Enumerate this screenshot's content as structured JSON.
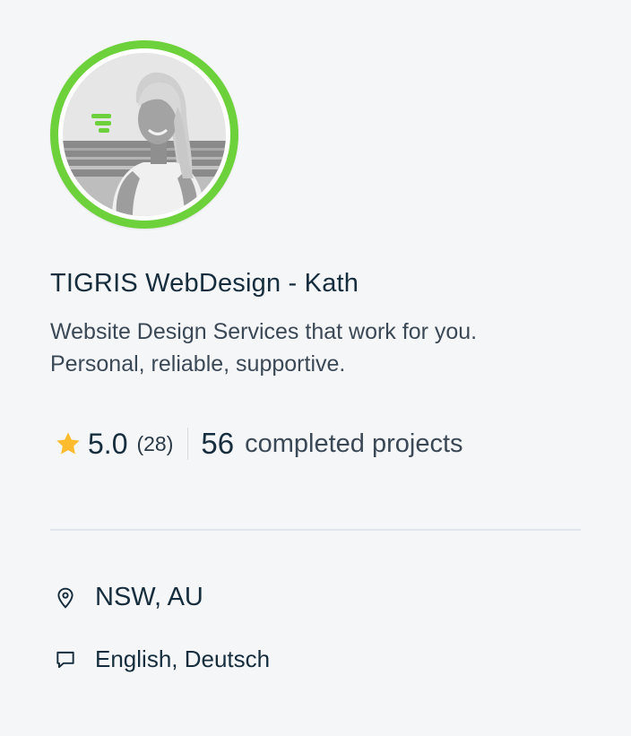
{
  "profile": {
    "name": "TIGRIS WebDesign - Kath",
    "tagline_line1": "Website Design Services that work for you.",
    "tagline_line2": "Personal, reliable, supportive."
  },
  "stats": {
    "rating": "5.0",
    "review_count": "(28)",
    "projects_count": "56",
    "projects_label": "completed projects"
  },
  "details": {
    "location": "NSW, AU",
    "languages": "English, Deutsch"
  },
  "icons": {
    "rating": "star-icon",
    "location": "location-pin-icon",
    "languages": "speech-bubble-icon"
  },
  "colors": {
    "avatar_ring": "#6cd13a",
    "star": "#fdbb2d",
    "background": "#f5f6f8",
    "text_primary": "#162d3d",
    "divider": "#dfe5eb"
  }
}
